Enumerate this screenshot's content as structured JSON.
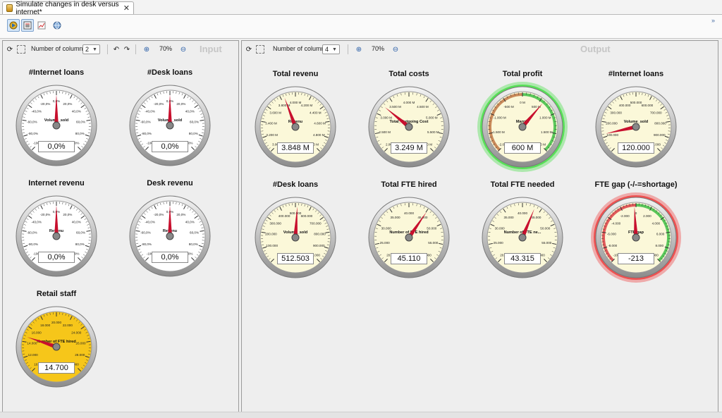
{
  "window": {
    "tab_title": "Simulate changes in desk versus internet*",
    "tab_close": "✕",
    "expand_chevron": "»"
  },
  "toolbar": {
    "buttons": [
      {
        "icon": "simulate-icon",
        "selected": true
      },
      {
        "icon": "list-icon",
        "selected": true
      },
      {
        "icon": "chart-icon",
        "selected": false
      },
      {
        "icon": "globe-icon",
        "selected": false
      }
    ]
  },
  "panels": {
    "input": {
      "title": "Input",
      "columns_label": "Number of columns",
      "columns_value": "2",
      "zoom": "70%",
      "gauges": [
        {
          "title": "#Internet loans",
          "label": "Volume_sold",
          "value": "0,0%",
          "min": -100,
          "max": 100,
          "val": 0,
          "ticks": [
            "-100,0%",
            "-80,0%",
            "-60,0%",
            "-40,0%",
            "-20,0%",
            "0,0%",
            "20,0%",
            "40,0%",
            "60,0%",
            "80,0%",
            "100,0%"
          ],
          "face": "white",
          "rim": "grey"
        },
        {
          "title": "#Desk loans",
          "label": "Volume_sold",
          "value": "0,0%",
          "min": -100,
          "max": 100,
          "val": 0,
          "ticks": [
            "-100,0%",
            "-80,0%",
            "-60,0%",
            "-40,0%",
            "-20,0%",
            "0,0%",
            "20,0%",
            "40,0%",
            "60,0%",
            "80,0%",
            "100,0%"
          ],
          "face": "white",
          "rim": "grey"
        },
        {
          "title": "Internet revenu",
          "label": "Revenu",
          "value": "0,0%",
          "min": -100,
          "max": 100,
          "val": 0,
          "ticks": [
            "-100,0%",
            "-80,0%",
            "-60,0%",
            "-40,0%",
            "-20,0%",
            "0,0%",
            "20,0%",
            "40,0%",
            "60,0%",
            "80,0%",
            "100,0%"
          ],
          "face": "white",
          "rim": "grey"
        },
        {
          "title": "Desk revenu",
          "label": "Revenu",
          "value": "0,0%",
          "min": -100,
          "max": 100,
          "val": 0,
          "ticks": [
            "-100,0%",
            "-80,0%",
            "-60,0%",
            "-40,0%",
            "-20,0%",
            "0,0%",
            "20,0%",
            "40,0%",
            "60,0%",
            "80,0%",
            "100,0%"
          ],
          "face": "white",
          "rim": "grey"
        },
        {
          "title": "Retail staff",
          "label": "Number of FTE hired",
          "value": "14.700",
          "min": 10000,
          "max": 30000,
          "val": 14700,
          "ticks": [
            "10.000",
            "12.000",
            "14.000",
            "16.000",
            "18.000",
            "20.000",
            "22.000",
            "24.000",
            "26.000",
            "28.000",
            "30.000"
          ],
          "face": "yellow",
          "rim": "grey"
        }
      ]
    },
    "output": {
      "title": "Output",
      "columns_label": "Number of columns",
      "columns_value": "4",
      "zoom": "70%",
      "gauges": [
        {
          "title": "Total revenu",
          "label": "Revenu",
          "value": "3.848 M",
          "min": 3000,
          "max": 5000,
          "val": 3848,
          "ticks": [
            "3.000 M",
            "3.200 M",
            "3.400 M",
            "3.600 M",
            "3.800 M",
            "4.000 M",
            "4.200 M",
            "4.400 M",
            "4.600 M",
            "4.800 M",
            "5.000 M"
          ],
          "face": "cream",
          "rim": "grey"
        },
        {
          "title": "Total costs",
          "label": "Total_Outgoing Cost",
          "value": "3.249 M",
          "min": 2000,
          "max": 6000,
          "val": 3249,
          "ticks": [
            "2.000 M",
            "2.500 M",
            "3.000 M",
            "3.500 M",
            "4.000 M",
            "4.500 M",
            "5.000 M",
            "5.500 M",
            "6.000 M"
          ],
          "face": "cream",
          "rim": "grey"
        },
        {
          "title": "Total profit",
          "label": "Margin",
          "value": "600 M",
          "min": -2000,
          "max": 2000,
          "val": 600,
          "ticks": [
            "-2.000 M",
            "-1.500 M",
            "-1.000 M",
            "-500 M",
            "0 M",
            "500 M",
            "1.000 M",
            "1.500 M",
            "2.000 M"
          ],
          "face": "cream",
          "rim": "green"
        },
        {
          "title": "#Internet loans",
          "label": "Volume_sold",
          "value": "120.000",
          "min": 0,
          "max": 1000000,
          "val": 120000,
          "ticks": [
            "0",
            "100.000",
            "200.000",
            "300.000",
            "400.000",
            "500.000",
            "600.000",
            "700.000",
            "800.000",
            "900.000",
            "1.000.000"
          ],
          "face": "cream",
          "rim": "grey"
        },
        {
          "title": "#Desk loans",
          "label": "Volume_sold",
          "value": "512.503",
          "min": 0,
          "max": 1000000,
          "val": 512503,
          "ticks": [
            "0",
            "100.000",
            "200.000",
            "300.000",
            "400.000",
            "500.000",
            "600.000",
            "700.000",
            "800.000",
            "900.000",
            "1.000.000"
          ],
          "face": "cream",
          "rim": "grey"
        },
        {
          "title": "Total FTE hired",
          "label": "Number of FTE hired",
          "value": "45.110",
          "min": 20000,
          "max": 60000,
          "val": 45110,
          "ticks": [
            "20.000",
            "25.000",
            "30.000",
            "35.000",
            "40.000",
            "45.000",
            "50.000",
            "55.000",
            "60.000"
          ],
          "face": "cream",
          "rim": "grey"
        },
        {
          "title": "Total FTE needed",
          "label": "Number of FTE ne...",
          "value": "43.315",
          "min": 20000,
          "max": 60000,
          "val": 43315,
          "ticks": [
            "20.000",
            "25.000",
            "30.000",
            "35.000",
            "40.000",
            "45.000",
            "50.000",
            "55.000",
            "60.000"
          ],
          "face": "cream",
          "rim": "grey"
        },
        {
          "title": "FTE gap (-/-=shortage)",
          "label": "FTE gap",
          "value": "-213",
          "min": -10000,
          "max": 10000,
          "val": -213,
          "ticks": [
            "-10.000",
            "-8.000",
            "-6.000",
            "-4.000",
            "-2.000",
            "0",
            "2.000",
            "4.000",
            "6.000",
            "8.000",
            "10.000"
          ],
          "face": "cream",
          "rim": "red"
        }
      ]
    }
  },
  "colors": {
    "needle": "#c8102e",
    "face_white": "#ffffff",
    "face_cream": "#fbf8d9",
    "face_yellow": "#f6c61a",
    "rim_green": "#33dd33",
    "rim_red": "#ee2b2b"
  }
}
